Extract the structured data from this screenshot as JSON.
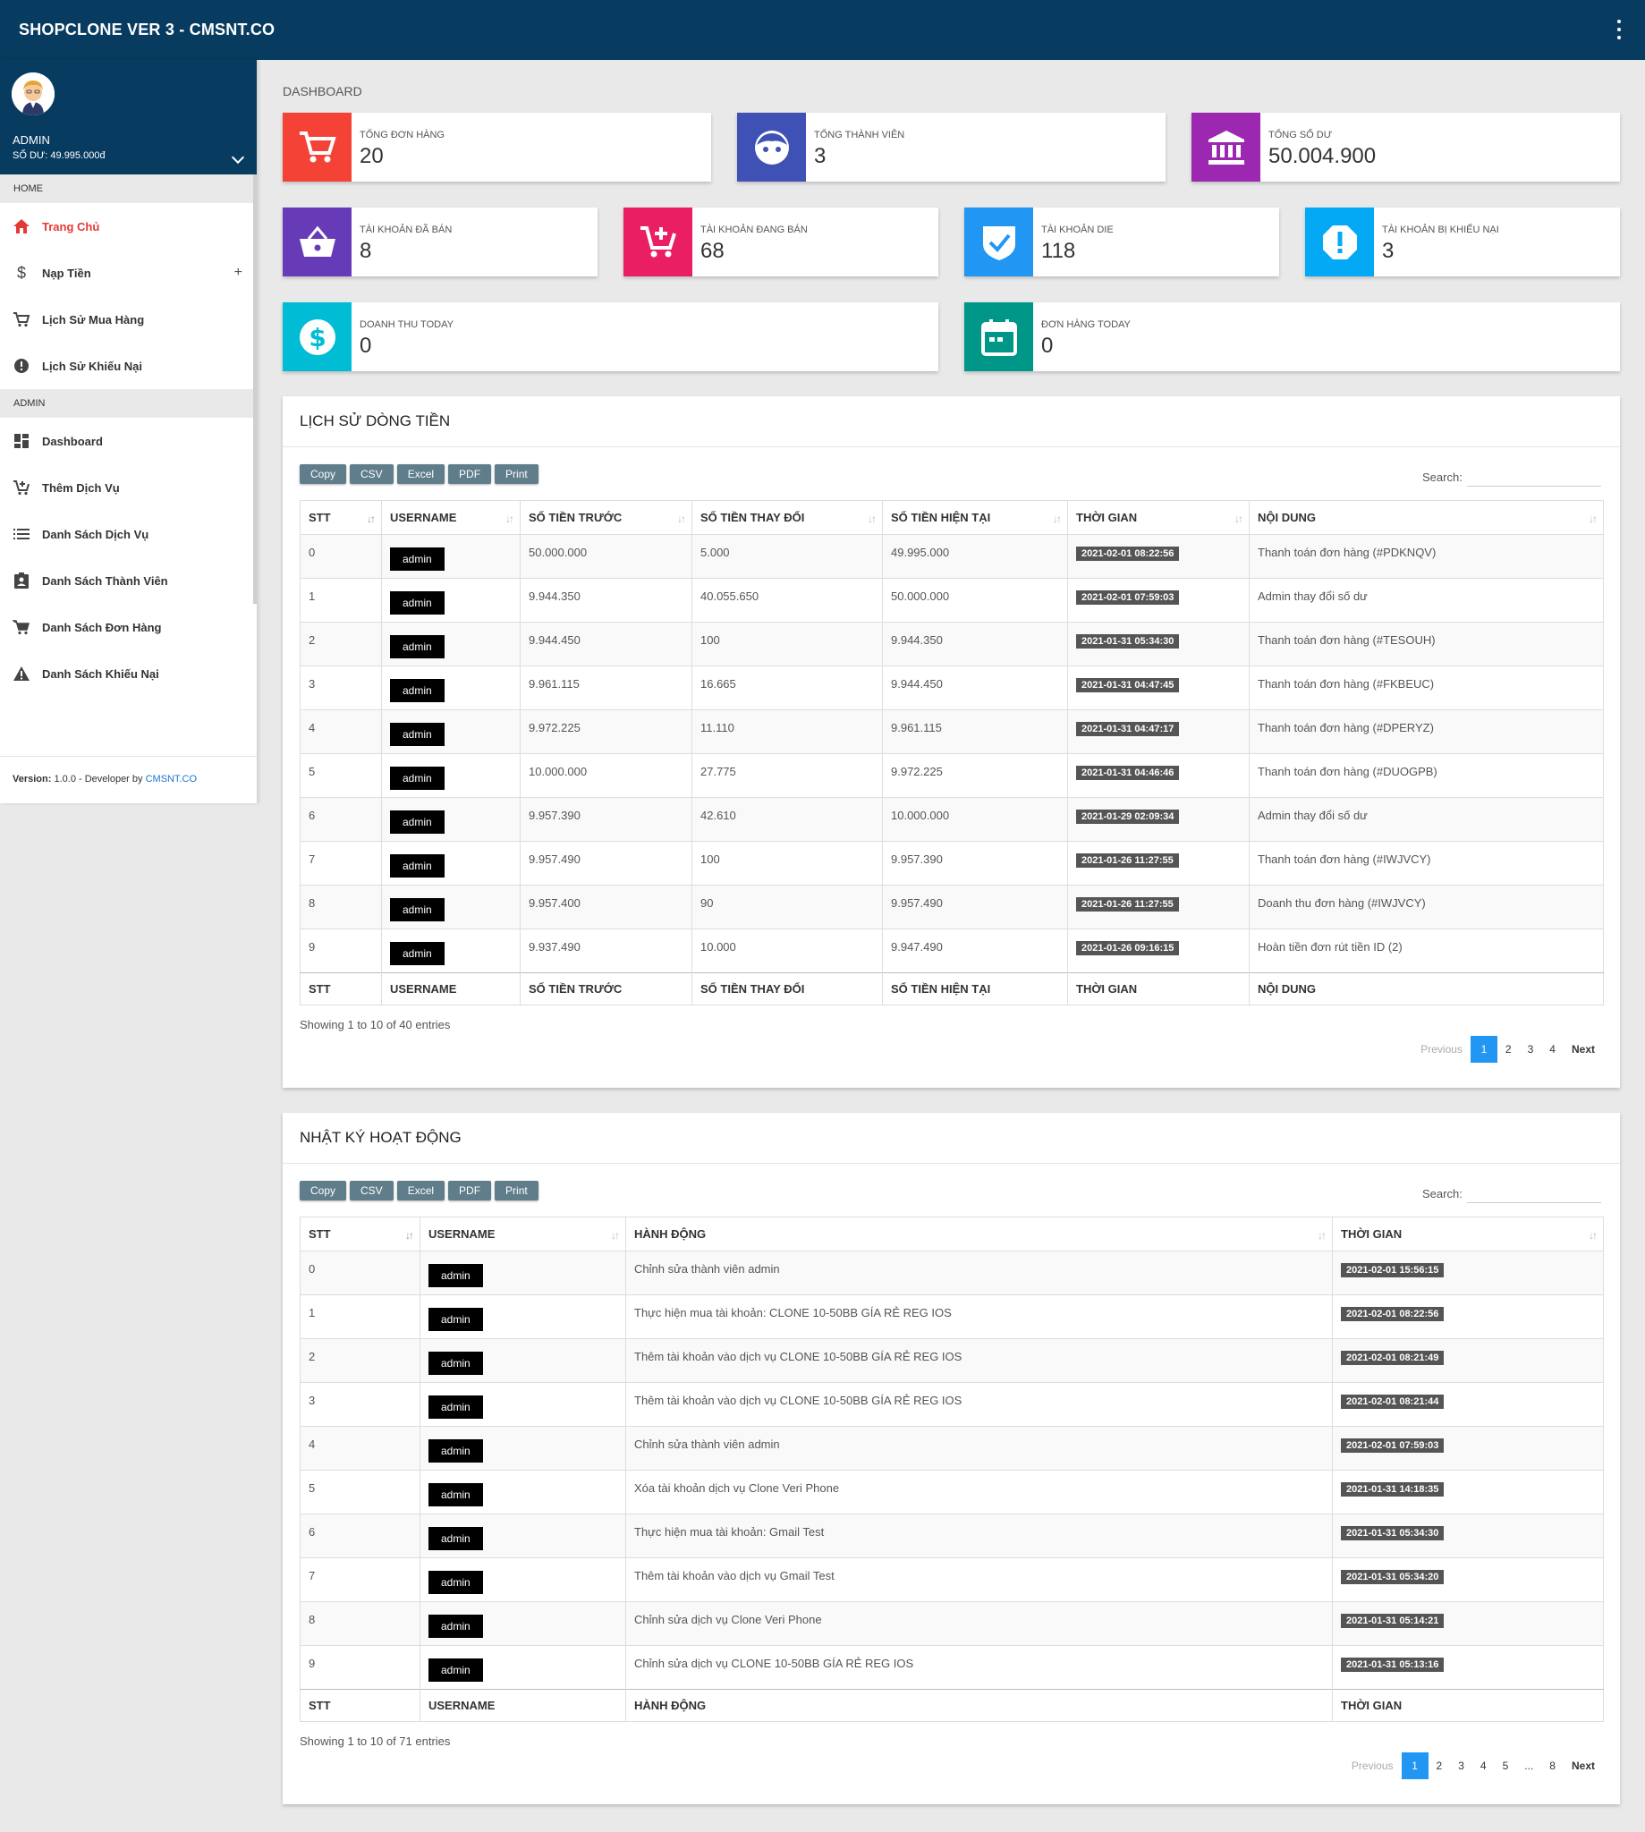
{
  "app": {
    "title": "SHOPCLONE VER 3 - CMSNT.CO"
  },
  "user": {
    "name": "ADMIN",
    "balance": "SỐ DƯ: 49.995.000đ"
  },
  "sidebar": {
    "home_header": "HOME",
    "admin_header": "ADMIN",
    "home_items": [
      {
        "label": "Trang Chủ",
        "icon": "home-icon"
      },
      {
        "label": "Nạp Tiền",
        "icon": "dollar-icon"
      },
      {
        "label": "Lịch Sử Mua Hàng",
        "icon": "cart-icon"
      },
      {
        "label": "Lịch Sử Khiếu Nại",
        "icon": "alert-circle-icon"
      }
    ],
    "admin_items": [
      {
        "label": "Dashboard",
        "icon": "dashboard-icon"
      },
      {
        "label": "Thêm Dịch Vụ",
        "icon": "cart-add-icon"
      },
      {
        "label": "Danh Sách Dịch Vụ",
        "icon": "list-icon"
      },
      {
        "label": "Danh Sách Thành Viên",
        "icon": "member-icon"
      },
      {
        "label": "Danh Sách Đơn Hàng",
        "icon": "cart-icon"
      },
      {
        "label": "Danh Sách Khiếu Nại",
        "icon": "warning-icon"
      }
    ],
    "plus": "+",
    "footer": {
      "label": "Version:",
      "version": "1.0.0 - Developer by",
      "link": "CMSNT.CO"
    }
  },
  "breadcrumb": "DASHBOARD",
  "stats": [
    {
      "label": "TỔNG ĐƠN HÀNG",
      "value": "20",
      "color": "#f44336",
      "icon": "cart-icon"
    },
    {
      "label": "TỔNG THÀNH VIÊN",
      "value": "3",
      "color": "#3f51b5",
      "icon": "face-icon"
    },
    {
      "label": "TỔNG SỐ DƯ",
      "value": "50.004.900",
      "color": "#9c27b0",
      "icon": "bank-icon"
    },
    {
      "label": "TÀI KHOẢN ĐÃ BÁN",
      "value": "8",
      "color": "#673ab7",
      "icon": "basket-icon"
    },
    {
      "label": "TÀI KHOẢN ĐANG BÁN",
      "value": "68",
      "color": "#e91e63",
      "icon": "cart-add-icon"
    },
    {
      "label": "TÀI KHOẢN DIE",
      "value": "118",
      "color": "#2196f3",
      "icon": "shield-check-icon"
    },
    {
      "label": "TÀI KHOẢN BỊ KHIẾU NẠI",
      "value": "3",
      "color": "#03a9f4",
      "icon": "alert-octagon-icon"
    },
    {
      "label": "DOANH THU TODAY",
      "value": "0",
      "color": "#00bcd4",
      "icon": "money-icon"
    },
    {
      "label": "ĐƠN HÀNG TODAY",
      "value": "0",
      "color": "#009688",
      "icon": "calendar-icon"
    }
  ],
  "export_buttons": [
    "Copy",
    "CSV",
    "Excel",
    "PDF",
    "Print"
  ],
  "search_label": "Search:",
  "cash": {
    "title": "LỊCH SỬ DÒNG TIỀN",
    "columns": [
      "STT",
      "USERNAME",
      "SỐ TIỀN TRƯỚC",
      "SỐ TIỀN THAY ĐỔI",
      "SỐ TIỀN HIỆN TẠI",
      "THỜI GIAN",
      "NỘI DUNG"
    ],
    "rows": [
      [
        "0",
        "admin",
        "50.000.000",
        "5.000",
        "49.995.000",
        "2021-02-01 08:22:56",
        "Thanh toán đơn hàng (#PDKNQV)"
      ],
      [
        "1",
        "admin",
        "9.944.350",
        "40.055.650",
        "50.000.000",
        "2021-02-01 07:59:03",
        "Admin thay đổi số dư"
      ],
      [
        "2",
        "admin",
        "9.944.450",
        "100",
        "9.944.350",
        "2021-01-31 05:34:30",
        "Thanh toán đơn hàng (#TESOUH)"
      ],
      [
        "3",
        "admin",
        "9.961.115",
        "16.665",
        "9.944.450",
        "2021-01-31 04:47:45",
        "Thanh toán đơn hàng (#FKBEUC)"
      ],
      [
        "4",
        "admin",
        "9.972.225",
        "11.110",
        "9.961.115",
        "2021-01-31 04:47:17",
        "Thanh toán đơn hàng (#DPERYZ)"
      ],
      [
        "5",
        "admin",
        "10.000.000",
        "27.775",
        "9.972.225",
        "2021-01-31 04:46:46",
        "Thanh toán đơn hàng (#DUOGPB)"
      ],
      [
        "6",
        "admin",
        "9.957.390",
        "42.610",
        "10.000.000",
        "2021-01-29 02:09:34",
        "Admin thay đổi số dư"
      ],
      [
        "7",
        "admin",
        "9.957.490",
        "100",
        "9.957.390",
        "2021-01-26 11:27:55",
        "Thanh toán đơn hàng (#IWJVCY)"
      ],
      [
        "8",
        "admin",
        "9.957.400",
        "90",
        "9.957.490",
        "2021-01-26 11:27:55",
        "Doanh thu đơn hàng (#IWJVCY)"
      ],
      [
        "9",
        "admin",
        "9.937.490",
        "10.000",
        "9.947.490",
        "2021-01-26 09:16:15",
        "Hoàn tiền đơn rút tiền ID (2)"
      ]
    ],
    "showing": "Showing 1 to 10 of 40 entries",
    "pager": [
      "Previous",
      "1",
      "2",
      "3",
      "4",
      "Next"
    ]
  },
  "log": {
    "title": "NHẬT KÝ HOẠT ĐỘNG",
    "columns": [
      "STT",
      "USERNAME",
      "HÀNH ĐỘNG",
      "THỜI GIAN"
    ],
    "rows": [
      [
        "0",
        "admin",
        "Chỉnh sửa thành viên admin",
        "2021-02-01 15:56:15"
      ],
      [
        "1",
        "admin",
        "Thực hiện mua tài khoản: CLONE 10-50BB GÍA RẺ REG IOS",
        "2021-02-01 08:22:56"
      ],
      [
        "2",
        "admin",
        "Thêm tài khoản vào dịch vụ CLONE 10-50BB GÍA RẺ REG IOS",
        "2021-02-01 08:21:49"
      ],
      [
        "3",
        "admin",
        "Thêm tài khoản vào dịch vụ CLONE 10-50BB GÍA RẺ REG IOS",
        "2021-02-01 08:21:44"
      ],
      [
        "4",
        "admin",
        "Chỉnh sửa thành viên admin",
        "2021-02-01 07:59:03"
      ],
      [
        "5",
        "admin",
        "Xóa tài khoản dịch vụ Clone Veri Phone",
        "2021-01-31 14:18:35"
      ],
      [
        "6",
        "admin",
        "Thực hiện mua tài khoản: Gmail Test",
        "2021-01-31 05:34:30"
      ],
      [
        "7",
        "admin",
        "Thêm tài khoản vào dịch vụ Gmail Test",
        "2021-01-31 05:34:20"
      ],
      [
        "8",
        "admin",
        "Chỉnh sửa dịch vụ Clone Veri Phone",
        "2021-01-31 05:14:21"
      ],
      [
        "9",
        "admin",
        "Chỉnh sửa dịch vụ CLONE 10-50BB GÍA RẺ REG IOS",
        "2021-01-31 05:13:16"
      ]
    ],
    "showing": "Showing 1 to 10 of 71 entries",
    "pager": [
      "Previous",
      "1",
      "2",
      "3",
      "4",
      "5",
      "...",
      "8",
      "Next"
    ]
  }
}
